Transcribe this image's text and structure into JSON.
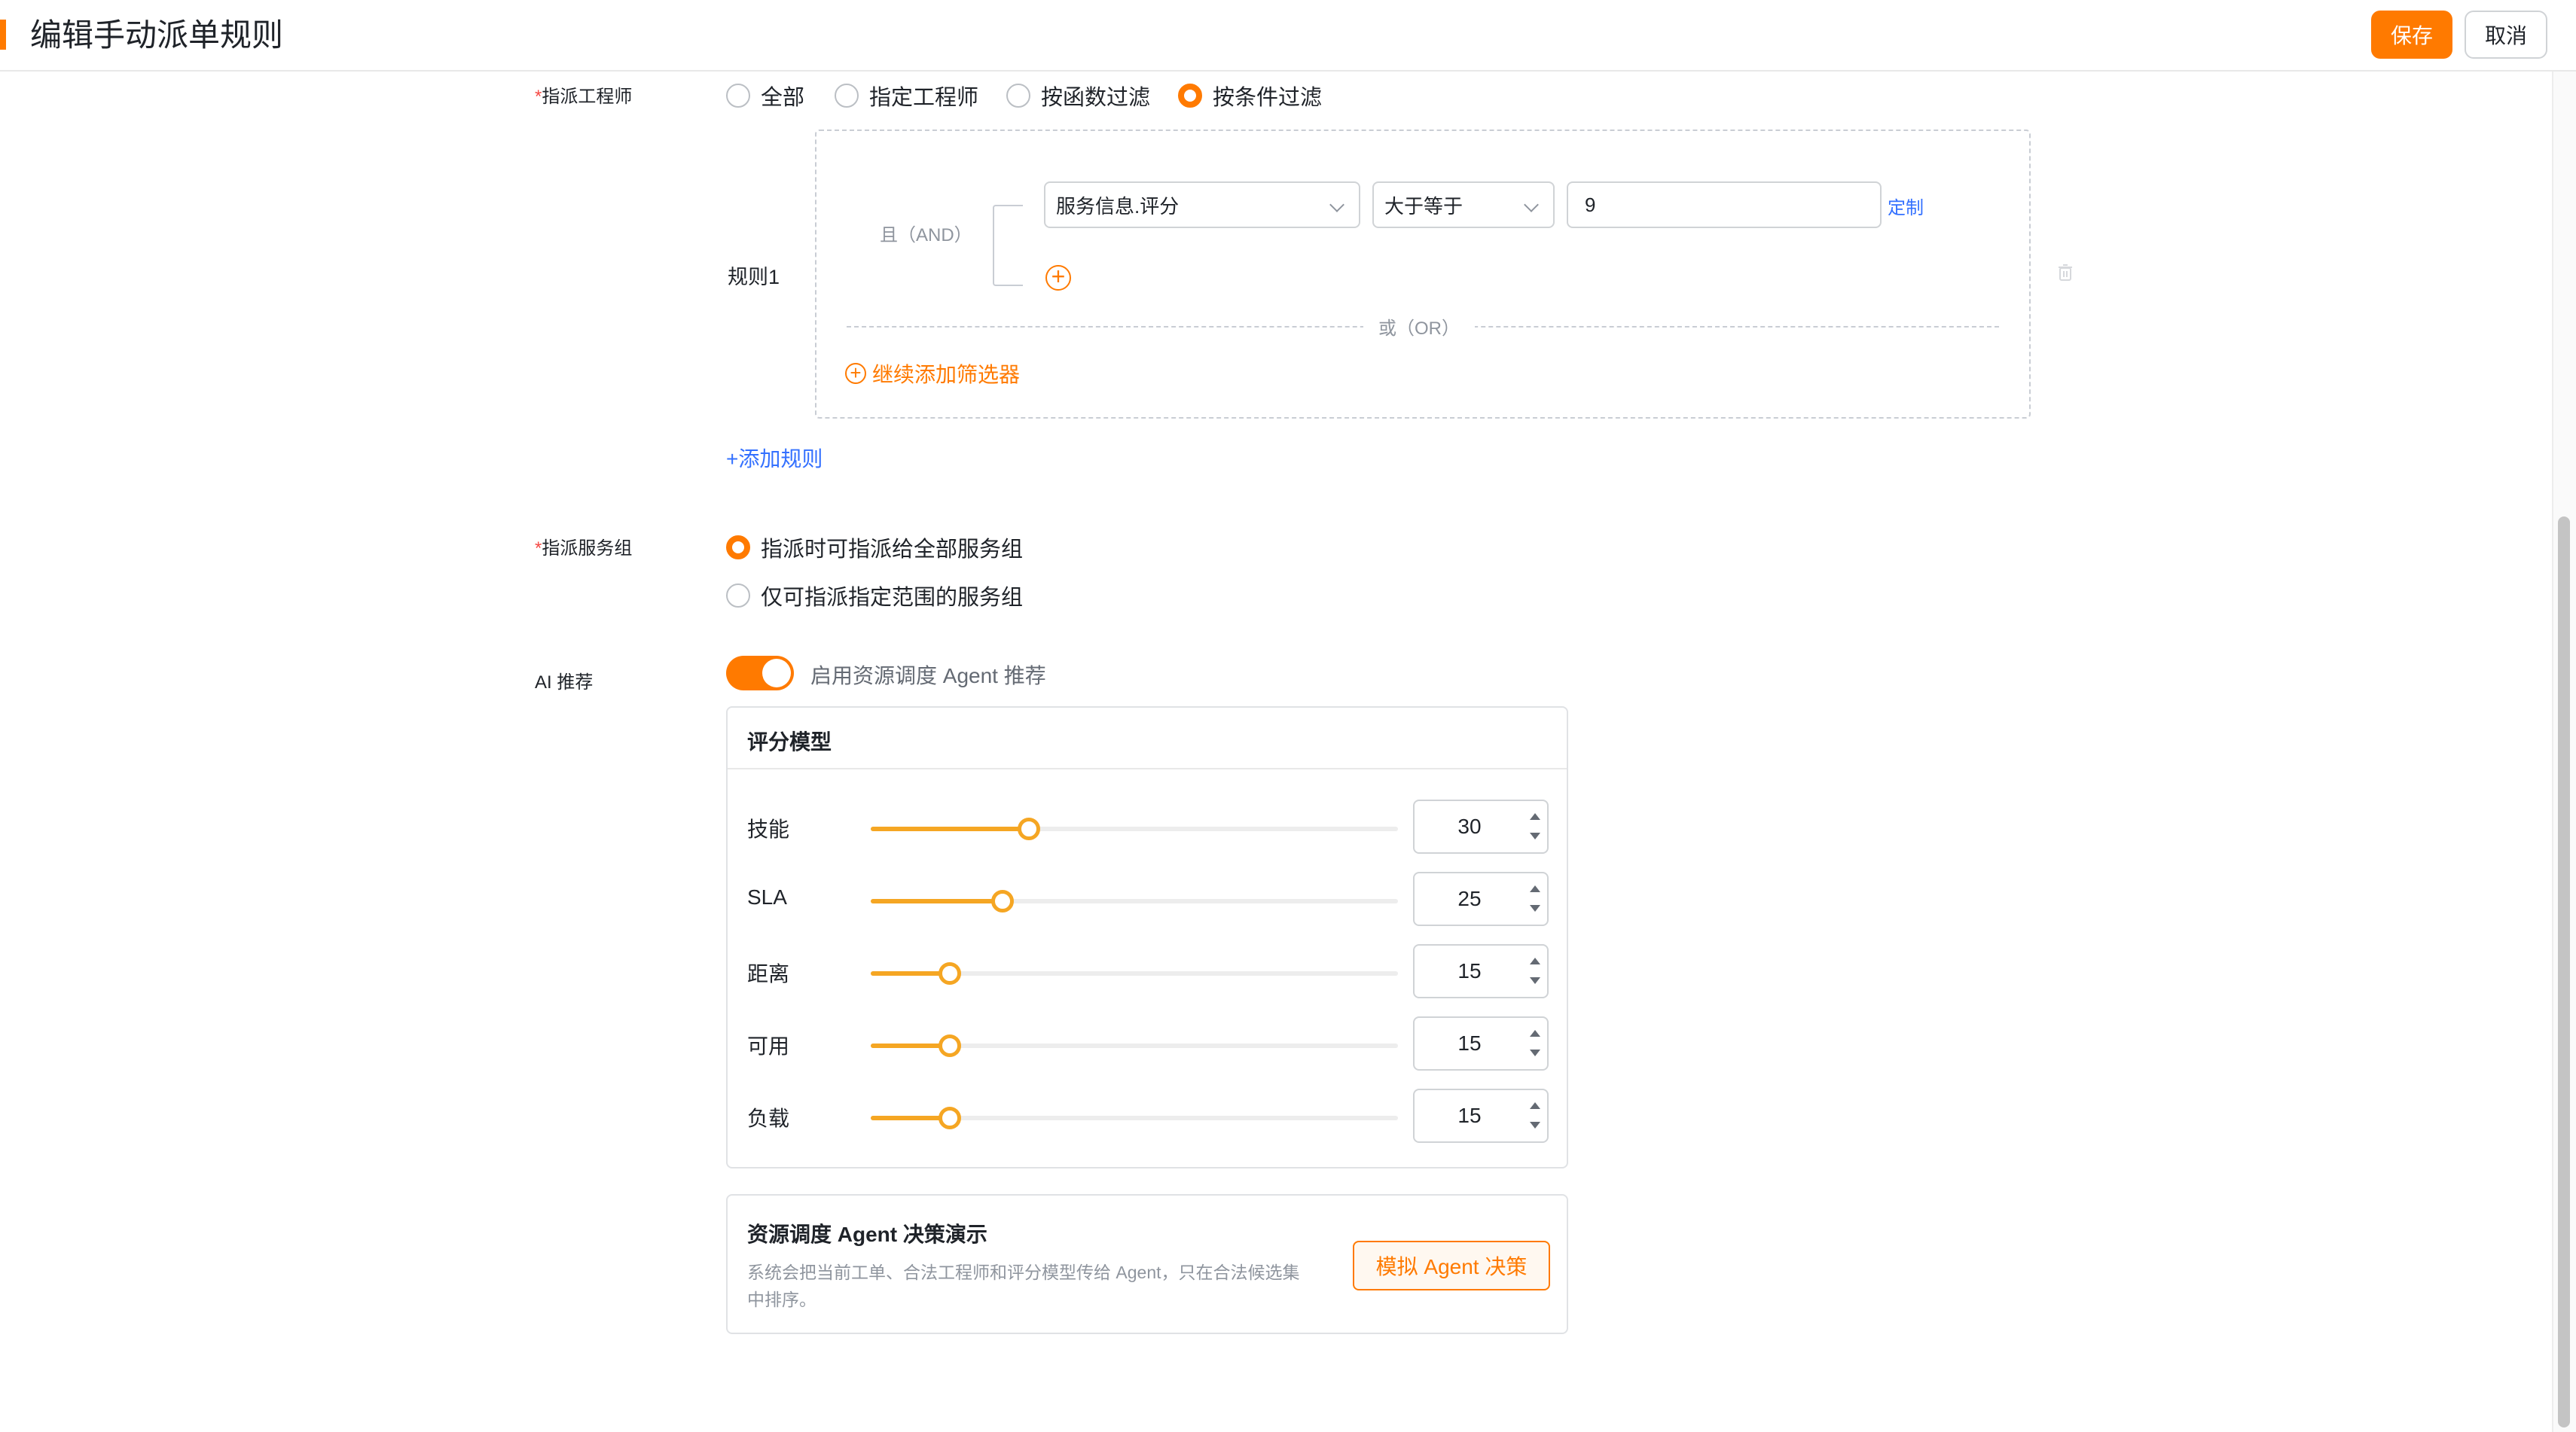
{
  "header": {
    "title": "编辑手动派单规则",
    "save_label": "保存",
    "cancel_label": "取消"
  },
  "engineer": {
    "label_required": "*",
    "label": "指派工程师",
    "options": [
      "全部",
      "指定工程师",
      "按函数过滤",
      "按条件过滤"
    ],
    "selected_index": 3
  },
  "rule": {
    "name": "规则1",
    "and_label": "且（AND）",
    "field": "服务信息.评分",
    "operator": "大于等于",
    "value": "9",
    "custom_link": "定制",
    "or_label": "或（OR）",
    "add_filter_label": "继续添加筛选器",
    "add_rule_label": "+添加规则"
  },
  "service_group": {
    "label_required": "*",
    "label": "指派服务组",
    "options": [
      "指派时可指派给全部服务组",
      "仅可指派指定范围的服务组"
    ],
    "selected_index": 0
  },
  "ai": {
    "label": "AI 推荐",
    "toggle_on": true,
    "toggle_label": "启用资源调度 Agent 推荐",
    "score_model_title": "评分模型",
    "sliders": [
      {
        "name": "技能",
        "value": 30
      },
      {
        "name": "SLA",
        "value": 25
      },
      {
        "name": "距离",
        "value": 15
      },
      {
        "name": "可用",
        "value": 15
      },
      {
        "name": "负载",
        "value": 15
      }
    ],
    "slider_max": 100,
    "demo_title": "资源调度 Agent 决策演示",
    "demo_desc": "系统会把当前工单、合法工程师和评分模型传给 Agent，只在合法候选集中排序。",
    "demo_button": "模拟 Agent 决策"
  },
  "colors": {
    "accent": "#ff7a00",
    "slider": "#f5a623",
    "link": "#3370ff"
  }
}
